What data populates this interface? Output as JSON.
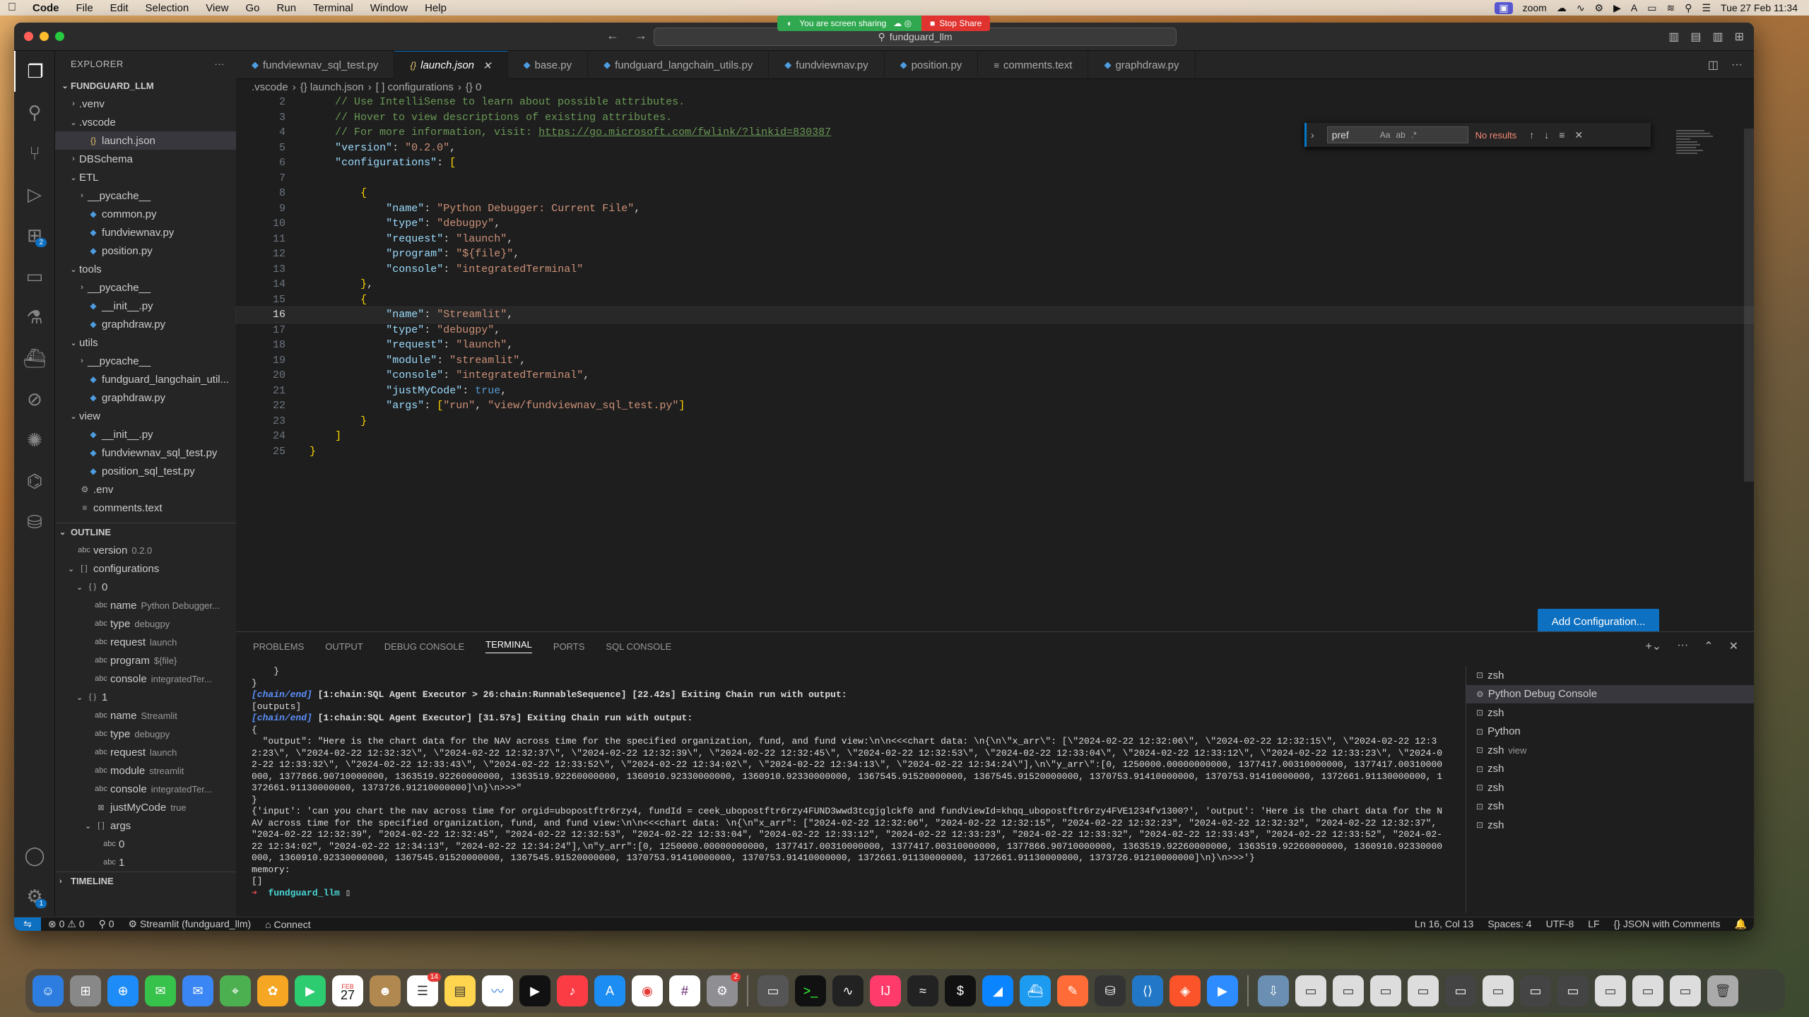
{
  "menubar": {
    "app": "Code",
    "items": [
      "File",
      "Edit",
      "Selection",
      "View",
      "Go",
      "Run",
      "Terminal",
      "Window",
      "Help"
    ],
    "zoom_label": "zoom",
    "clock": "Tue 27 Feb 11:34"
  },
  "share_banner": {
    "sharing": "You are screen sharing",
    "stop": "Stop Share"
  },
  "title": {
    "command_center": "fundguard_llm"
  },
  "explorer": {
    "header": "EXPLORER",
    "root": "FUNDGUARD_LLM",
    "items": [
      {
        "label": ".venv",
        "type": "folder",
        "depth": 1,
        "open": false
      },
      {
        "label": ".vscode",
        "type": "folder",
        "depth": 1,
        "open": true
      },
      {
        "label": "launch.json",
        "type": "json",
        "depth": 2,
        "selected": true
      },
      {
        "label": "DBSchema",
        "type": "folder",
        "depth": 1,
        "open": false
      },
      {
        "label": "ETL",
        "type": "folder",
        "depth": 1,
        "open": true
      },
      {
        "label": "__pycache__",
        "type": "folder",
        "depth": 2,
        "open": false
      },
      {
        "label": "common.py",
        "type": "py",
        "depth": 2
      },
      {
        "label": "fundviewnav.py",
        "type": "py",
        "depth": 2
      },
      {
        "label": "position.py",
        "type": "py",
        "depth": 2
      },
      {
        "label": "tools",
        "type": "folder",
        "depth": 1,
        "open": true
      },
      {
        "label": "__pycache__",
        "type": "folder",
        "depth": 2,
        "open": false
      },
      {
        "label": "__init__.py",
        "type": "py",
        "depth": 2
      },
      {
        "label": "graphdraw.py",
        "type": "py",
        "depth": 2
      },
      {
        "label": "utils",
        "type": "folder",
        "depth": 1,
        "open": true
      },
      {
        "label": "__pycache__",
        "type": "folder",
        "depth": 2,
        "open": false
      },
      {
        "label": "fundguard_langchain_util...",
        "type": "py",
        "depth": 2
      },
      {
        "label": "graphdraw.py",
        "type": "py",
        "depth": 2
      },
      {
        "label": "view",
        "type": "folder",
        "depth": 1,
        "open": true
      },
      {
        "label": "__init__.py",
        "type": "py",
        "depth": 2
      },
      {
        "label": "fundviewnav_sql_test.py",
        "type": "py",
        "depth": 2
      },
      {
        "label": "position_sql_test.py",
        "type": "py",
        "depth": 2
      },
      {
        "label": ".env",
        "type": "gear",
        "depth": 1
      },
      {
        "label": "comments.text",
        "type": "text",
        "depth": 1
      }
    ]
  },
  "outline": {
    "header": "OUTLINE",
    "items": [
      {
        "label": "version",
        "value": "0.2.0",
        "depth": 1,
        "icon": "abc"
      },
      {
        "label": "configurations",
        "value": "",
        "depth": 1,
        "icon": "[ ]",
        "chev": "v"
      },
      {
        "label": "0",
        "value": "",
        "depth": 2,
        "icon": "{ }",
        "chev": "v"
      },
      {
        "label": "name",
        "value": "Python Debugger...",
        "depth": 3,
        "icon": "abc"
      },
      {
        "label": "type",
        "value": "debugpy",
        "depth": 3,
        "icon": "abc"
      },
      {
        "label": "request",
        "value": "launch",
        "depth": 3,
        "icon": "abc"
      },
      {
        "label": "program",
        "value": "${file}",
        "depth": 3,
        "icon": "abc"
      },
      {
        "label": "console",
        "value": "integratedTer...",
        "depth": 3,
        "icon": "abc"
      },
      {
        "label": "1",
        "value": "",
        "depth": 2,
        "icon": "{ }",
        "chev": "v"
      },
      {
        "label": "name",
        "value": "Streamlit",
        "depth": 3,
        "icon": "abc"
      },
      {
        "label": "type",
        "value": "debugpy",
        "depth": 3,
        "icon": "abc"
      },
      {
        "label": "request",
        "value": "launch",
        "depth": 3,
        "icon": "abc"
      },
      {
        "label": "module",
        "value": "streamlit",
        "depth": 3,
        "icon": "abc"
      },
      {
        "label": "console",
        "value": "integratedTer...",
        "depth": 3,
        "icon": "abc"
      },
      {
        "label": "justMyCode",
        "value": "true",
        "depth": 3,
        "icon": "⊠"
      },
      {
        "label": "args",
        "value": "",
        "depth": 3,
        "icon": "[ ]",
        "chev": "v"
      },
      {
        "label": "0",
        "value": "",
        "depth": 4,
        "icon": "abc"
      },
      {
        "label": "1",
        "value": "",
        "depth": 4,
        "icon": "abc"
      }
    ],
    "timeline": "TIMELINE"
  },
  "tabs": [
    {
      "label": "fundviewnav_sql_test.py",
      "type": "py"
    },
    {
      "label": "launch.json",
      "type": "json",
      "active": true
    },
    {
      "label": "base.py",
      "type": "py"
    },
    {
      "label": "fundguard_langchain_utils.py",
      "type": "py"
    },
    {
      "label": "fundviewnav.py",
      "type": "py"
    },
    {
      "label": "position.py",
      "type": "py"
    },
    {
      "label": "comments.text",
      "type": "text"
    },
    {
      "label": "graphdraw.py",
      "type": "py"
    }
  ],
  "breadcrumb": [
    ".vscode",
    "{} launch.json",
    "[ ] configurations",
    "{} 0"
  ],
  "find": {
    "value": "pref",
    "result": "No results"
  },
  "add_configuration": "Add Configuration...",
  "code_lines": [
    {
      "n": "2",
      "t": "    // Use IntelliSense to learn about possible attributes."
    },
    {
      "n": "3",
      "t": "    // Hover to view descriptions of existing attributes."
    },
    {
      "n": "4",
      "t": "    // For more information, visit: https://go.microsoft.com/fwlink/?linkid=830387"
    },
    {
      "n": "5",
      "t": "    \"version\": \"0.2.0\","
    },
    {
      "n": "6",
      "t": "    \"configurations\": ["
    },
    {
      "n": "7",
      "t": ""
    },
    {
      "n": "8",
      "t": "        {"
    },
    {
      "n": "9",
      "t": "            \"name\": \"Python Debugger: Current File\","
    },
    {
      "n": "10",
      "t": "            \"type\": \"debugpy\","
    },
    {
      "n": "11",
      "t": "            \"request\": \"launch\","
    },
    {
      "n": "12",
      "t": "            \"program\": \"${file}\","
    },
    {
      "n": "13",
      "t": "            \"console\": \"integratedTerminal\""
    },
    {
      "n": "14",
      "t": "        },"
    },
    {
      "n": "15",
      "t": "        {"
    },
    {
      "n": "16",
      "t": "            \"name\": \"Streamlit\","
    },
    {
      "n": "17",
      "t": "            \"type\": \"debugpy\","
    },
    {
      "n": "18",
      "t": "            \"request\": \"launch\","
    },
    {
      "n": "19",
      "t": "            \"module\": \"streamlit\","
    },
    {
      "n": "20",
      "t": "            \"console\": \"integratedTerminal\","
    },
    {
      "n": "21",
      "t": "            \"justMyCode\": true,"
    },
    {
      "n": "22",
      "t": "            \"args\": [\"run\", \"view/fundviewnav_sql_test.py\"]"
    },
    {
      "n": "23",
      "t": "        }"
    },
    {
      "n": "24",
      "t": "    ]"
    },
    {
      "n": "25",
      "t": "}"
    }
  ],
  "panel": {
    "tabs": [
      "PROBLEMS",
      "OUTPUT",
      "DEBUG CONSOLE",
      "TERMINAL",
      "PORTS",
      "SQL CONSOLE"
    ],
    "active": "TERMINAL",
    "terminal_lines": [
      "    }",
      "}",
      "[chain/end] [1:chain:SQL Agent Executor > 26:chain:RunnableSequence] [22.42s] Exiting Chain run with output:",
      "[outputs]",
      "[chain/end] [1:chain:SQL Agent Executor] [31.57s] Exiting Chain run with output:",
      "{",
      "  \"output\": \"Here is the chart data for the NAV across time for the specified organization, fund, and fund view:\\n\\n<<<chart data: \\n{\\n\\\"x_arr\\\": [\\\"2024-02-22 12:32:06\\\", \\\"2024-02-22 12:32:15\\\", \\\"2024-02-22 12:32:23\\\", \\\"2024-02-22 12:32:32\\\", \\\"2024-02-22 12:32:37\\\", \\\"2024-02-22 12:32:39\\\", \\\"2024-02-22 12:32:45\\\", \\\"2024-02-22 12:32:53\\\", \\\"2024-02-22 12:33:04\\\", \\\"2024-02-22 12:33:12\\\", \\\"2024-02-22 12:33:23\\\", \\\"2024-02-22 12:33:32\\\", \\\"2024-02-22 12:33:43\\\", \\\"2024-02-22 12:33:52\\\", \\\"2024-02-22 12:34:02\\\", \\\"2024-02-22 12:34:13\\\", \\\"2024-02-22 12:34:24\\\"],\\n\\\"y_arr\\\":[0, 1250000.00000000000, 1377417.00310000000, 1377417.00310000000, 1377866.90710000000, 1363519.92260000000, 1363519.92260000000, 1360910.92330000000, 1360910.92330000000, 1367545.91520000000, 1367545.91520000000, 1370753.91410000000, 1370753.91410000000, 1372661.91130000000, 1372661.91130000000, 1373726.91210000000]\\n}\\n>>>\"",
      "}",
      "{'input': 'can you chart the nav across time for orgid=ubopostftr6rzy4, fundId = ceek_ubopostftr6rzy4FUND3wwd3tcgjglckf0 and fundViewId=khqq_ubopostftr6rzy4FVE1234fv1300?', 'output': 'Here is the chart data for the NAV across time for the specified organization, fund, and fund view:\\n\\n<<<chart data: \\n{\\n\"x_arr\": [\"2024-02-22 12:32:06\", \"2024-02-22 12:32:15\", \"2024-02-22 12:32:23\", \"2024-02-22 12:32:32\", \"2024-02-22 12:32:37\", \"2024-02-22 12:32:39\", \"2024-02-22 12:32:45\", \"2024-02-22 12:32:53\", \"2024-02-22 12:33:04\", \"2024-02-22 12:33:12\", \"2024-02-22 12:33:23\", \"2024-02-22 12:33:32\", \"2024-02-22 12:33:43\", \"2024-02-22 12:33:52\", \"2024-02-22 12:34:02\", \"2024-02-22 12:34:13\", \"2024-02-22 12:34:24\"],\\n\"y_arr\":[0, 1250000.00000000000, 1377417.00310000000, 1377417.00310000000, 1377866.90710000000, 1363519.92260000000, 1363519.92260000000, 1360910.92330000000, 1360910.92330000000, 1367545.91520000000, 1367545.91520000000, 1370753.91410000000, 1370753.91410000000, 1372661.91130000000, 1372661.91130000000, 1373726.91210000000]\\n}\\n>>>'}",
      "memory:",
      "[]"
    ],
    "prompt_dir": "fundguard_llm",
    "terminals": [
      {
        "label": "zsh",
        "sub": ""
      },
      {
        "label": "Python Debug Console",
        "sub": "",
        "selected": true
      },
      {
        "label": "zsh",
        "sub": ""
      },
      {
        "label": "Python",
        "sub": ""
      },
      {
        "label": "zsh",
        "sub": "view"
      },
      {
        "label": "zsh",
        "sub": ""
      },
      {
        "label": "zsh",
        "sub": ""
      },
      {
        "label": "zsh",
        "sub": ""
      },
      {
        "label": "zsh",
        "sub": ""
      }
    ]
  },
  "statusbar": {
    "errors": "0",
    "warnings": "0",
    "ports": "0",
    "debug": "Streamlit (fundguard_llm)",
    "connect": "Connect",
    "position": "Ln 16, Col 13",
    "spaces": "Spaces: 4",
    "encoding": "UTF-8",
    "eol": "LF",
    "language": "JSON with Comments"
  },
  "dock": {
    "calendar_month": "FEB",
    "calendar_day": "27",
    "badge_reminders": "14",
    "badge_settings": "2"
  }
}
